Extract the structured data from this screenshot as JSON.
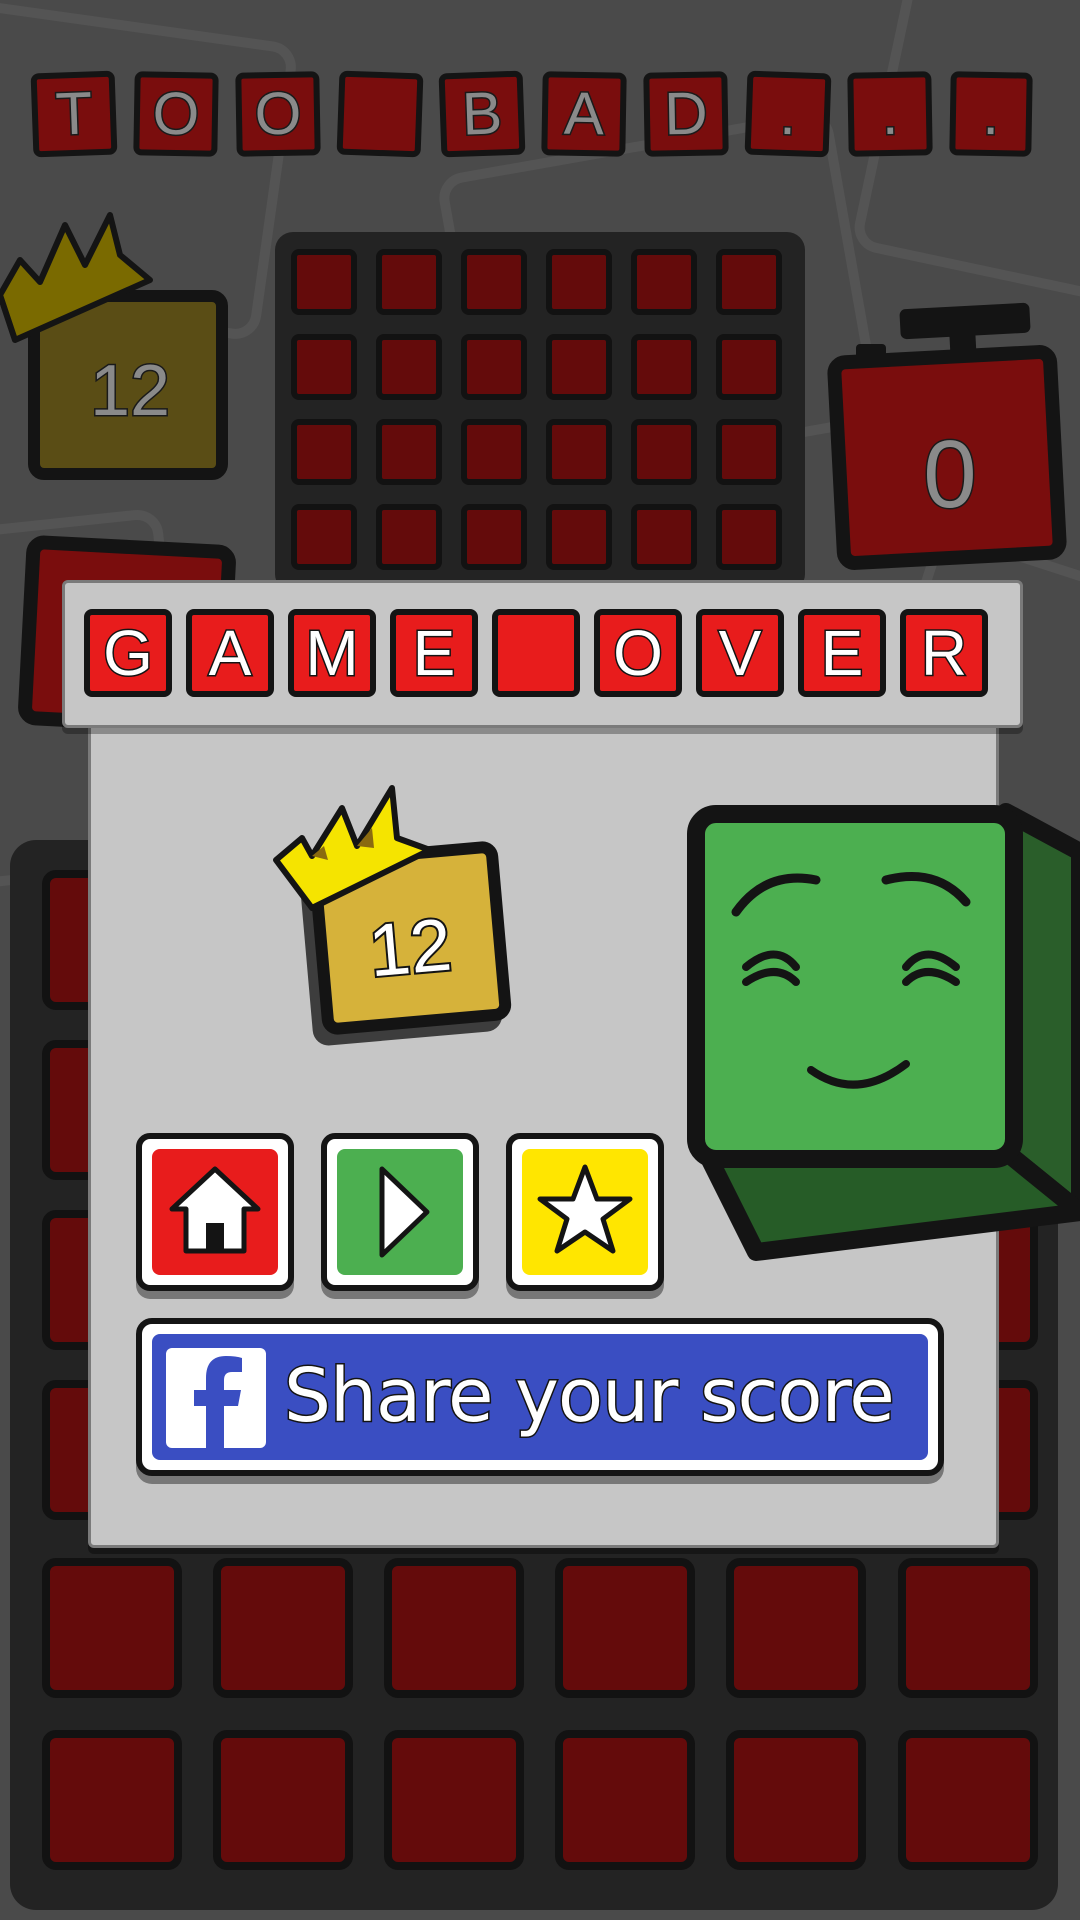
{
  "header": {
    "letters": [
      "T",
      "O",
      "O",
      "",
      "B",
      "A",
      "D",
      ".",
      ".",
      "."
    ]
  },
  "hud": {
    "best_score": "12",
    "timer": "0"
  },
  "dialog": {
    "title_letters": [
      "G",
      "A",
      "M",
      "E",
      "",
      "O",
      "V",
      "E",
      "R"
    ],
    "score": "12",
    "buttons": {
      "home_icon": "home-icon",
      "play_icon": "play-icon",
      "rate_icon": "star-icon"
    },
    "share": {
      "label": "Share your score",
      "icon": "facebook-icon"
    }
  },
  "colors": {
    "background": "#4a4a4a",
    "tile_dark_red": "#640b0b",
    "tile_red": "#e81c1c",
    "home_button": "#e81c1c",
    "play_button": "#4caf50",
    "rate_button": "#ffe600",
    "facebook_blue": "#3a4ec2",
    "cube_green": "#4caf50",
    "crown_yellow": "#f5e400",
    "score_tile": "#d6b23a"
  }
}
